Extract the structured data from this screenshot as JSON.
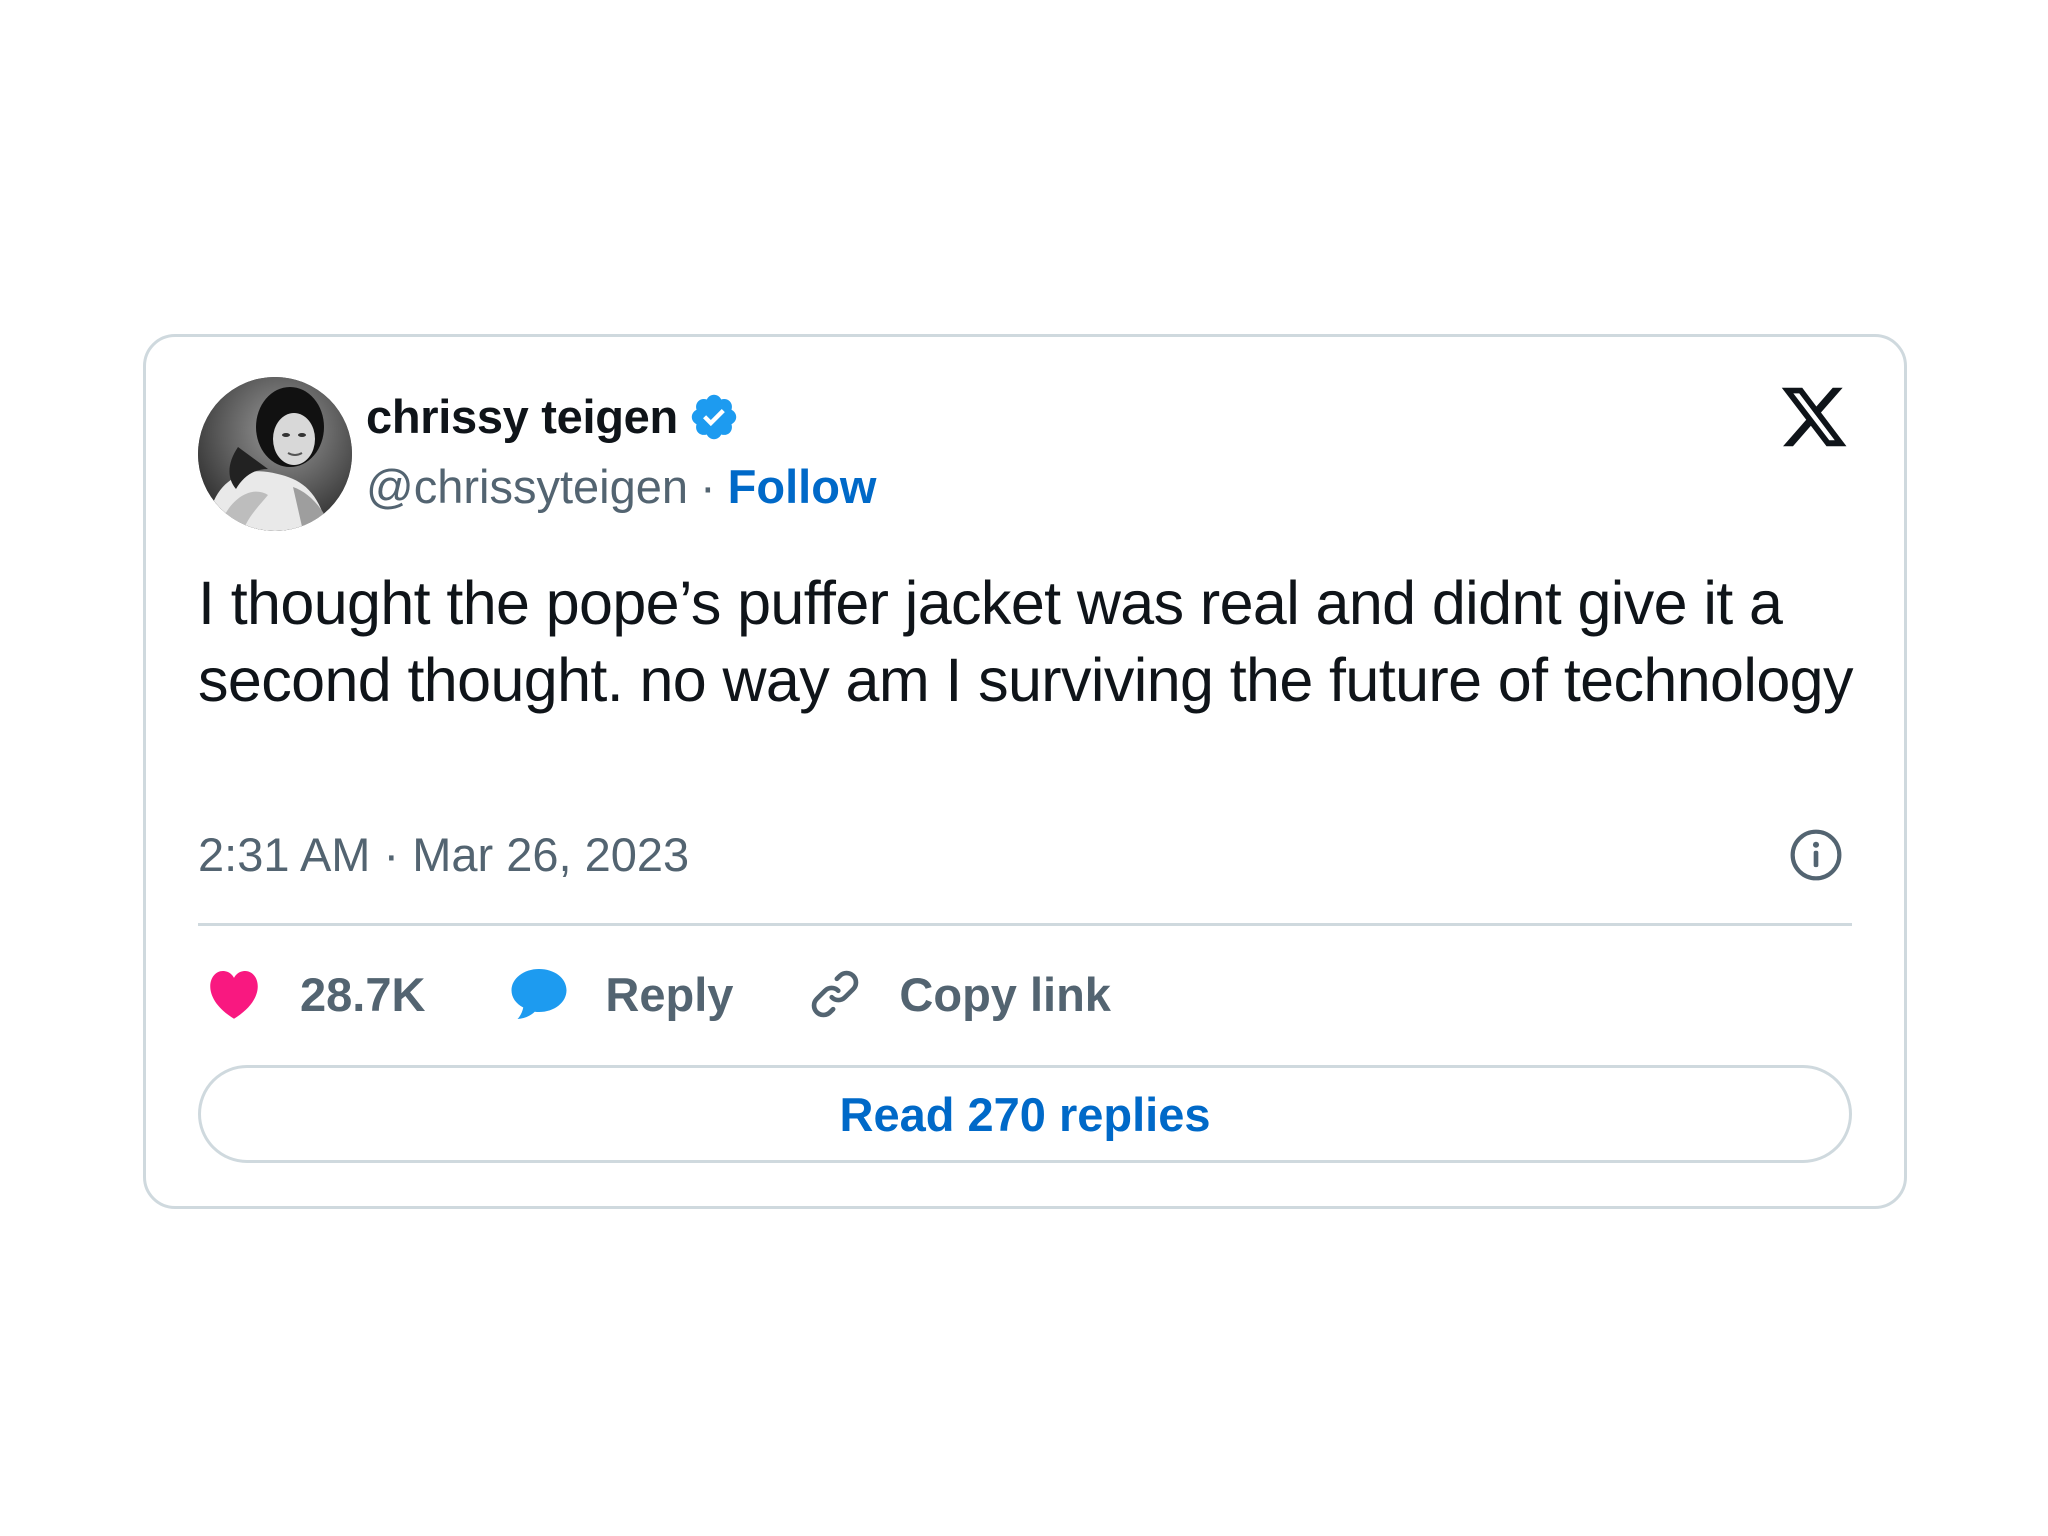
{
  "author": {
    "display_name": "chrissy teigen",
    "handle": "@chrissyteigen",
    "separator": "·",
    "follow_label": "Follow",
    "verified": true,
    "avatar": "profile-photo-avatar"
  },
  "brand": {
    "logo_icon": "x-logo-icon"
  },
  "tweet": {
    "text": "I thought the pope’s puffer jacket was real and didnt give it a second thought. no way am I surviving the future of technology",
    "timestamp": "2:31 AM · Mar 26, 2023"
  },
  "actions": {
    "likes_count": "28.7K",
    "reply_label": "Reply",
    "copy_link_label": "Copy link"
  },
  "footer": {
    "read_replies_label": "Read 270 replies"
  },
  "colors": {
    "link_blue": "#0069c8",
    "verified_blue": "#1d9bf0",
    "like_pink": "#f91880",
    "reply_blue": "#1d9bf0",
    "text_primary": "#0f1419",
    "text_secondary": "#536471",
    "border": "#cfd9de"
  }
}
